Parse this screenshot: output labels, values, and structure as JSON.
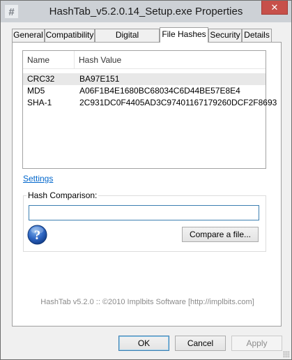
{
  "window": {
    "title": "HashTab_v5.2.0.14_Setup.exe Properties",
    "close_glyph": "✕",
    "app_icon": "hash-app-icon"
  },
  "tabs": [
    {
      "label": "General",
      "active": false
    },
    {
      "label": "Compatibility",
      "active": false
    },
    {
      "label": "Digital Signatures",
      "active": false
    },
    {
      "label": "File Hashes",
      "active": true
    },
    {
      "label": "Security",
      "active": false
    },
    {
      "label": "Details",
      "active": false
    }
  ],
  "hash_list": {
    "columns": [
      "Name",
      "Hash Value"
    ],
    "rows": [
      {
        "name": "CRC32",
        "value": "BA97E151",
        "selected": true
      },
      {
        "name": "MD5",
        "value": "A06F1B4E1680BC68034C6D44BE57E8E4",
        "selected": false
      },
      {
        "name": "SHA-1",
        "value": "2C931DC0F4405AD3C97401167179260DCF2F8693",
        "selected": false
      }
    ]
  },
  "settings_link": "Settings",
  "comparison": {
    "label": "Hash Comparison:",
    "input_value": "",
    "compare_button": "Compare a file...",
    "help_icon": "help-question-icon"
  },
  "footer": "HashTab v5.2.0 :: ©2010 Implbits Software [http://implbits.com]",
  "buttons": {
    "ok": "OK",
    "cancel": "Cancel",
    "apply": "Apply"
  },
  "colors": {
    "link": "#0066cc",
    "close_button": "#c7504a",
    "titlebar": "#cdd1d6",
    "focus_border": "#3c7fb1"
  }
}
